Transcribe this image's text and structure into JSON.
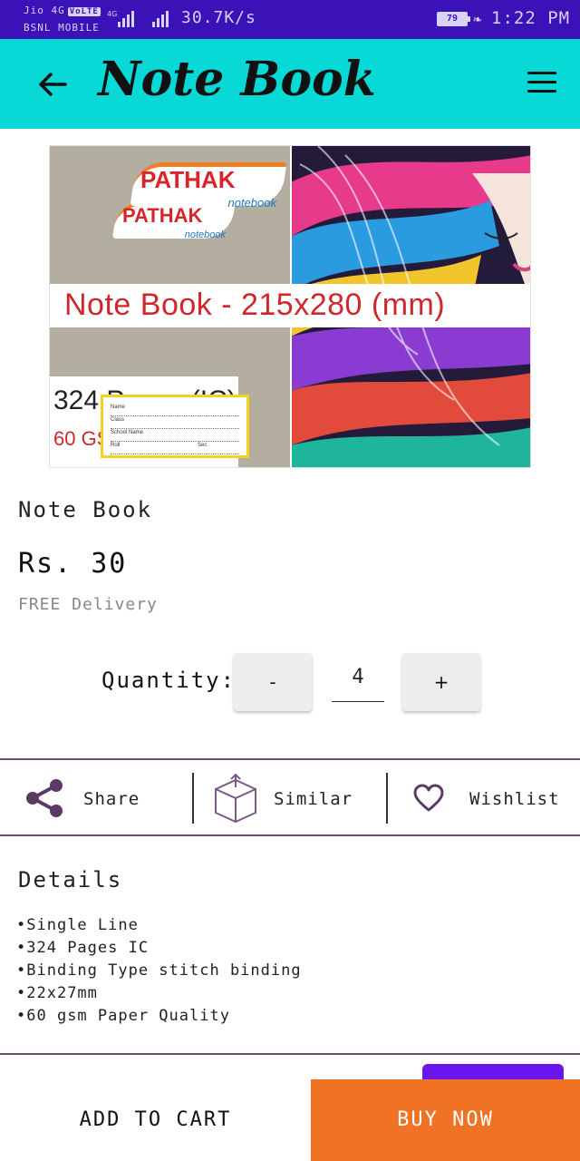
{
  "status_bar": {
    "carrier_line1": "Jio 4G",
    "volte": "VoLTE",
    "carrier_line2": "BSNL MOBILE",
    "network_4g": "4G",
    "speed": "30.7K/s",
    "battery": "79",
    "time": "1:22 PM"
  },
  "app_bar": {
    "title": "Note Book",
    "back_icon": "arrow-left-icon",
    "menu_icon": "hamburger-menu-icon"
  },
  "product_image": {
    "brand_name": "PATHAK",
    "brand_sub": "notebook",
    "banner_text": "Note Book - 215x280 (mm)",
    "pages_text": "324 Pages (IC)",
    "cover_text": "60 GSM Soft Cover",
    "label_fields": [
      "Name",
      "Class",
      "School Name",
      "Roll",
      "Sec"
    ]
  },
  "product": {
    "name": "Note Book",
    "price": "Rs. 30",
    "delivery": "FREE Delivery"
  },
  "quantity": {
    "label": "Quantity:",
    "minus_label": "-",
    "plus_label": "+",
    "value": "4"
  },
  "actions": {
    "share": "Share",
    "similar": "Similar",
    "wishlist": "Wishlist"
  },
  "details": {
    "title": "Details",
    "items": [
      "Single Line",
      "324 Pages IC",
      "Binding Type stitch binding",
      "22x27mm",
      "60 gsm Paper Quality"
    ]
  },
  "bottom_bar": {
    "add_to_cart": "ADD TO CART",
    "buy_now": "BUY NOW"
  },
  "colors": {
    "status_bar": "#3a12b8",
    "app_bar": "#08d8d6",
    "buy_now": "#f07224",
    "divider": "#6b4a75",
    "floating_button": "#6a14f0"
  }
}
